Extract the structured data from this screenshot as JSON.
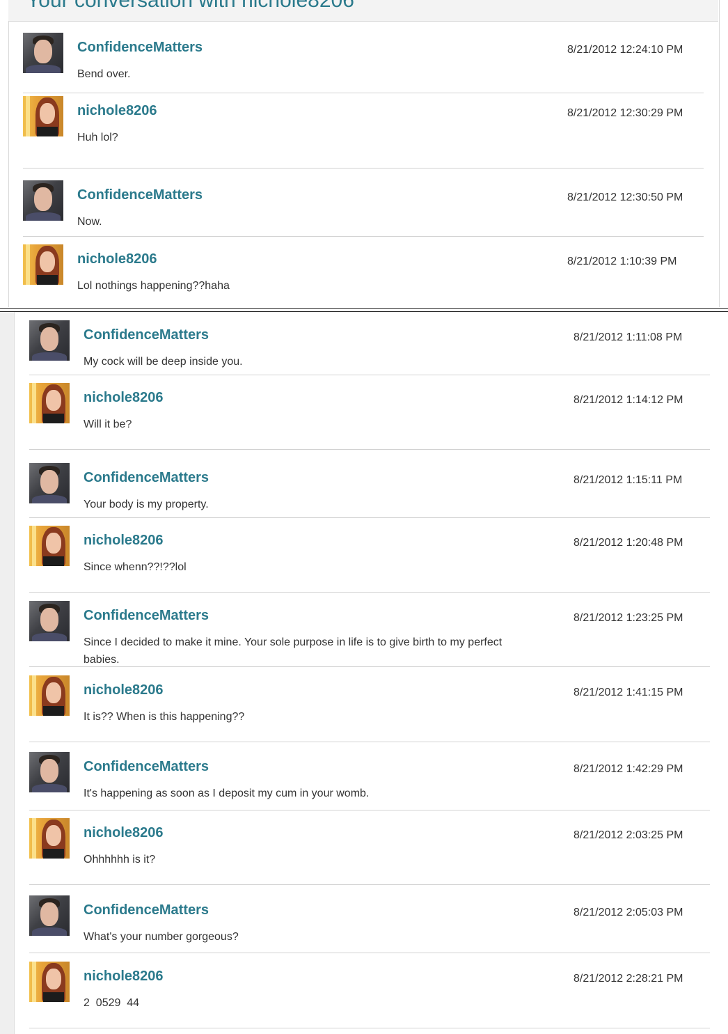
{
  "header": {
    "title": "Your conversation with nichole8206"
  },
  "messages": [
    {
      "user": "ConfidenceMatters",
      "time": "8/21/2012 12:24:10 PM",
      "text": "Bend over.",
      "avatar": "male-avatar"
    },
    {
      "user": "nichole8206",
      "time": "8/21/2012 12:30:29 PM",
      "text": "Huh lol?",
      "avatar": "female-avatar"
    },
    {
      "user": "ConfidenceMatters",
      "time": "8/21/2012 12:30:50 PM",
      "text": "Now.",
      "avatar": "male-avatar"
    },
    {
      "user": "nichole8206",
      "time": "8/21/2012 1:10:39 PM",
      "text": "Lol nothings happening??haha",
      "avatar": "female-avatar"
    },
    {
      "user": "ConfidenceMatters",
      "time": "8/21/2012 1:11:08 PM",
      "text": "My cock will be deep inside you.",
      "avatar": "male-avatar"
    },
    {
      "user": "nichole8206",
      "time": "8/21/2012 1:14:12 PM",
      "text": "Will it be?",
      "avatar": "female-avatar"
    },
    {
      "user": "ConfidenceMatters",
      "time": "8/21/2012 1:15:11 PM",
      "text": "Your body is my property.",
      "avatar": "male-avatar"
    },
    {
      "user": "nichole8206",
      "time": "8/21/2012 1:20:48 PM",
      "text": "Since whenn??!??lol",
      "avatar": "female-avatar"
    },
    {
      "user": "ConfidenceMatters",
      "time": "8/21/2012 1:23:25 PM",
      "text": "Since I decided to make it mine. Your sole purpose in life is to give birth to my perfect babies.",
      "avatar": "male-avatar"
    },
    {
      "user": "nichole8206",
      "time": "8/21/2012 1:41:15 PM",
      "text": "It is?? When is this happening??",
      "avatar": "female-avatar"
    },
    {
      "user": "ConfidenceMatters",
      "time": "8/21/2012 1:42:29 PM",
      "text": "It's happening as soon as I deposit my cum in your womb.",
      "avatar": "male-avatar"
    },
    {
      "user": "nichole8206",
      "time": "8/21/2012 2:03:25 PM",
      "text": "Ohhhhhh is it?",
      "avatar": "female-avatar"
    },
    {
      "user": "ConfidenceMatters",
      "time": "8/21/2012 2:05:03 PM",
      "text": "What's your number gorgeous?",
      "avatar": "male-avatar"
    },
    {
      "user": "nichole8206",
      "time": "8/21/2012 2:28:21 PM",
      "text": "2  0529  44",
      "avatar": "female-avatar"
    }
  ]
}
